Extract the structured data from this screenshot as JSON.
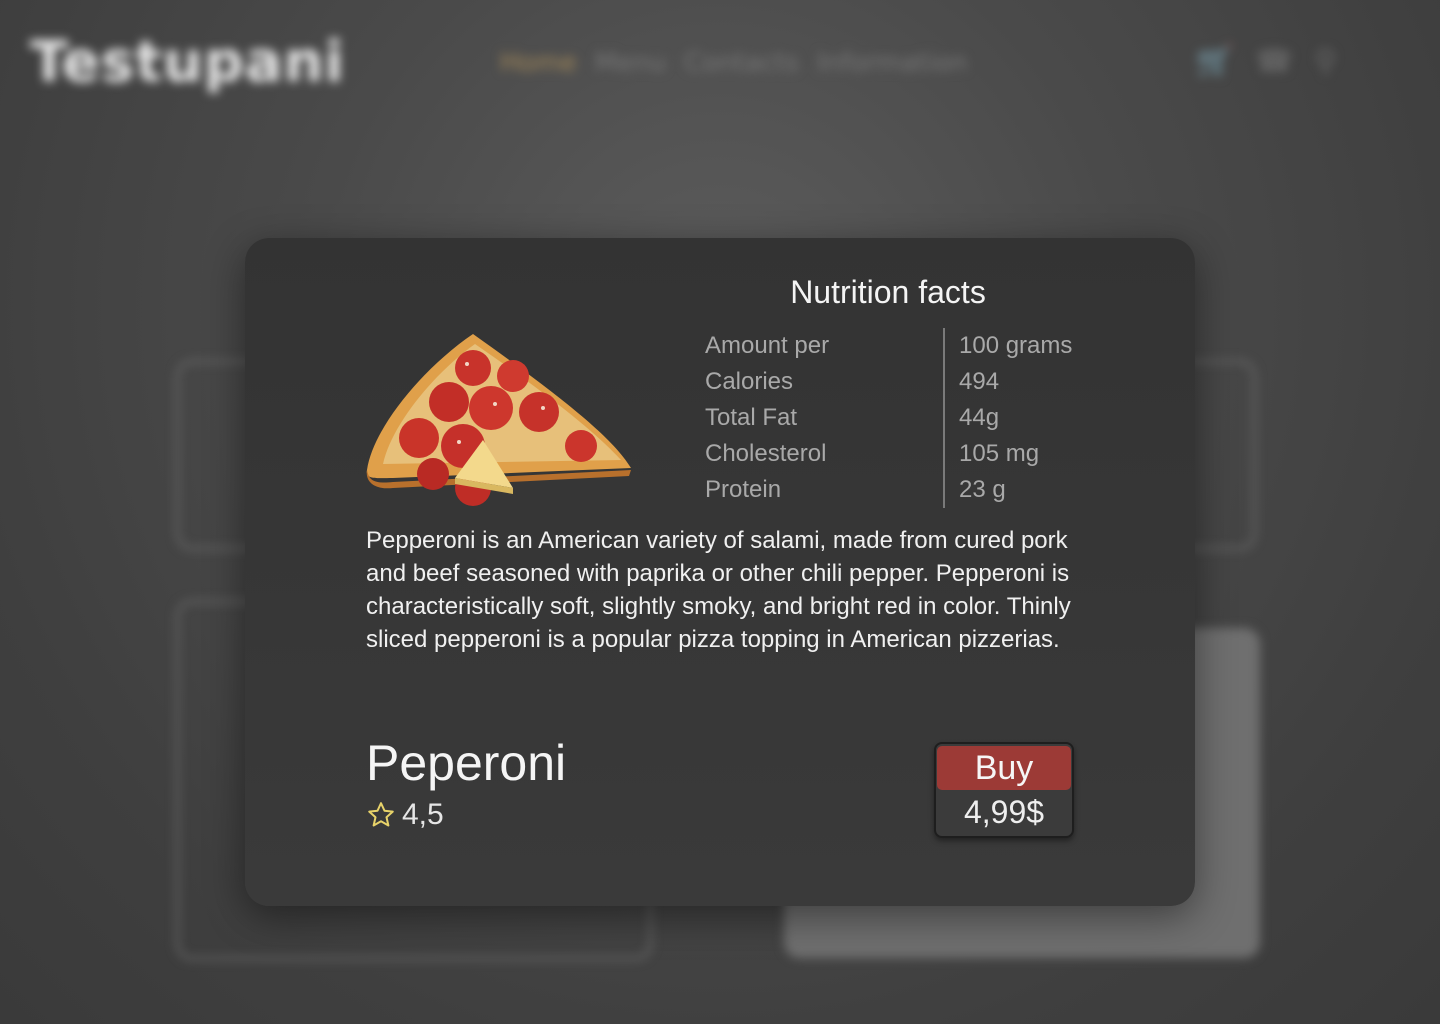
{
  "background": {
    "logo": "Testupani",
    "nav": [
      "Home",
      "Menu",
      "Contacts",
      "Information"
    ],
    "icons": [
      "cart-icon",
      "phone-icon",
      "search-icon"
    ]
  },
  "modal": {
    "nutrition": {
      "title": "Nutrition facts",
      "rows": [
        {
          "label": "Amount per",
          "value": "100 grams"
        },
        {
          "label": "Calories",
          "value": "494"
        },
        {
          "label": "Total Fat",
          "value": "44g"
        },
        {
          "label": "Cholesterol",
          "value": "105 mg"
        },
        {
          "label": "Protein",
          "value": "23 g"
        }
      ]
    },
    "description": "Pepperoni is an American variety of salami, made from cured pork and beef seasoned with paprika or other chili pepper. Pepperoni is characteristically soft, slightly smoky, and bright red in color. Thinly sliced pepperoni is a popular pizza topping in American pizzerias.",
    "product": {
      "name": "Peperoni",
      "rating": "4,5",
      "image": "pepperoni-pizza-slice"
    },
    "purchase": {
      "buy_label": "Buy",
      "price": "4,99$"
    }
  },
  "colors": {
    "accent": "#9c3a36",
    "modal_bg": "#353535",
    "star": "#e8d36a"
  }
}
